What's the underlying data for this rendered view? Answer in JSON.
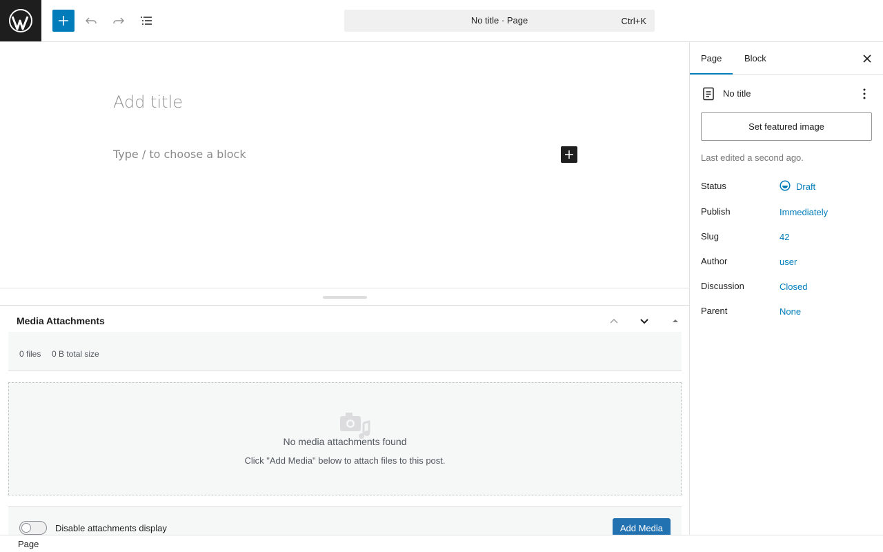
{
  "topbar": {
    "command_title": "No title · Page",
    "command_shortcut": "Ctrl+K"
  },
  "editor": {
    "title_placeholder": "Add title",
    "block_placeholder": "Type / to choose a block"
  },
  "metabox": {
    "title": "Media Attachments",
    "files_count": "0 files",
    "total_size": "0 B total size",
    "empty_title": "No media attachments found",
    "empty_subtitle": "Click \"Add Media\" below to attach files to this post.",
    "toggle_label": "Disable attachments display",
    "add_media_label": "Add Media"
  },
  "statusbar": {
    "breadcrumb": "Page"
  },
  "sidebar": {
    "tabs": [
      {
        "label": "Page",
        "active": true
      },
      {
        "label": "Block",
        "active": false
      }
    ],
    "doc_title": "No title",
    "featured_image_label": "Set featured image",
    "last_edited": "Last edited a second ago.",
    "properties": [
      {
        "label": "Status",
        "value": "Draft"
      },
      {
        "label": "Publish",
        "value": "Immediately"
      },
      {
        "label": "Slug",
        "value": "42"
      },
      {
        "label": "Author",
        "value": "user"
      },
      {
        "label": "Discussion",
        "value": "Closed"
      },
      {
        "label": "Parent",
        "value": "None"
      }
    ]
  },
  "colors": {
    "accent": "#007cba",
    "dark": "#1e1e1e",
    "add_media_bg": "#2271b1"
  }
}
